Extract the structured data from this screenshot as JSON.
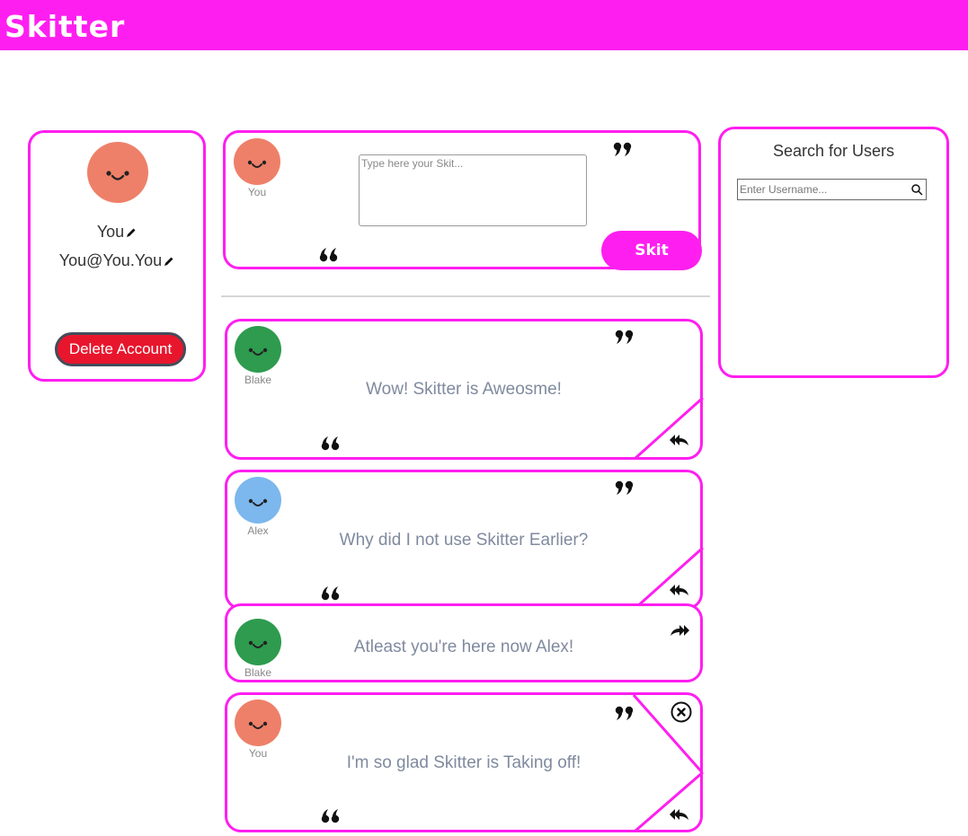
{
  "app": {
    "title": "Skitter"
  },
  "profile": {
    "name": "You",
    "email": "You@You.You",
    "delete_label": "Delete Account",
    "avatar_color": "#ee8069"
  },
  "composer": {
    "author": "You",
    "placeholder": "Type here your Skit...",
    "submit_label": "Skit",
    "avatar_color": "#ee8069"
  },
  "search": {
    "title": "Search for Users",
    "placeholder": "Enter Username..."
  },
  "posts": [
    {
      "author": "Blake",
      "text": "Wow! Skitter is Aweosme!",
      "avatar_color": "#2e9b4e"
    },
    {
      "author": "Alex",
      "text": "Why did I not use Skitter Earlier?",
      "avatar_color": "#7cb7ee"
    },
    {
      "author": "Blake",
      "text": "Atleast you're here now Alex!",
      "avatar_color": "#2e9b4e",
      "is_reply": true
    },
    {
      "author": "You",
      "text": "I'm so glad Skitter is Taking off!",
      "avatar_color": "#ee8069",
      "deletable": true
    }
  ],
  "colors": {
    "brand": "#ff1ef0",
    "danger": "#e8162d"
  },
  "icons": [
    "pencil-icon",
    "open-quote-icon",
    "close-quote-icon",
    "reply-icon",
    "forward-icon",
    "delete-icon",
    "search-icon"
  ]
}
